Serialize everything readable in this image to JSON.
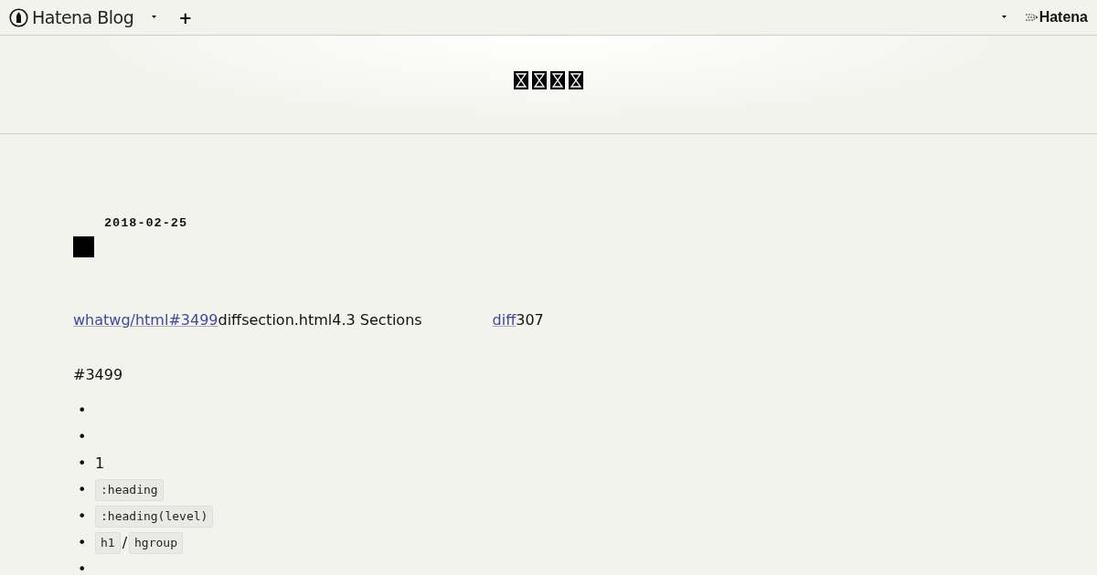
{
  "navbar": {
    "brand": "Hatena Blog",
    "add": "+",
    "account": "Hatena"
  },
  "blog_header": {
    "title": [
      {
        "kind": "missing_glyph"
      },
      {
        "kind": "missing_glyph"
      },
      {
        "kind": "missing_glyph"
      },
      {
        "kind": "missing_glyph"
      }
    ]
  },
  "entry": {
    "date": "2018-02-25",
    "intro": [
      {
        "kind": "link",
        "text": "whatwg/html#3499"
      },
      {
        "kind": "text",
        "text": "diffsection.html4.3 Sections"
      },
      {
        "kind": "gap"
      },
      {
        "kind": "link",
        "text": "diff"
      },
      {
        "kind": "text",
        "text": "307"
      }
    ],
    "paragraph": "#3499",
    "list": [
      {
        "bullet": "•"
      },
      {
        "bullet": "•"
      },
      {
        "bullet": "•",
        "parts": [
          {
            "kind": "text",
            "text": "1"
          }
        ]
      },
      {
        "bullet": "•",
        "parts": [
          {
            "kind": "code",
            "text": ":heading"
          }
        ]
      },
      {
        "bullet": "•",
        "parts": [
          {
            "kind": "code",
            "text": ":heading(level)"
          }
        ]
      },
      {
        "bullet": "•",
        "parts": [
          {
            "kind": "code",
            "text": "h1"
          },
          {
            "kind": "text",
            "text": "/"
          },
          {
            "kind": "code",
            "text": "hgroup"
          }
        ]
      },
      {
        "bullet": "•"
      }
    ]
  }
}
